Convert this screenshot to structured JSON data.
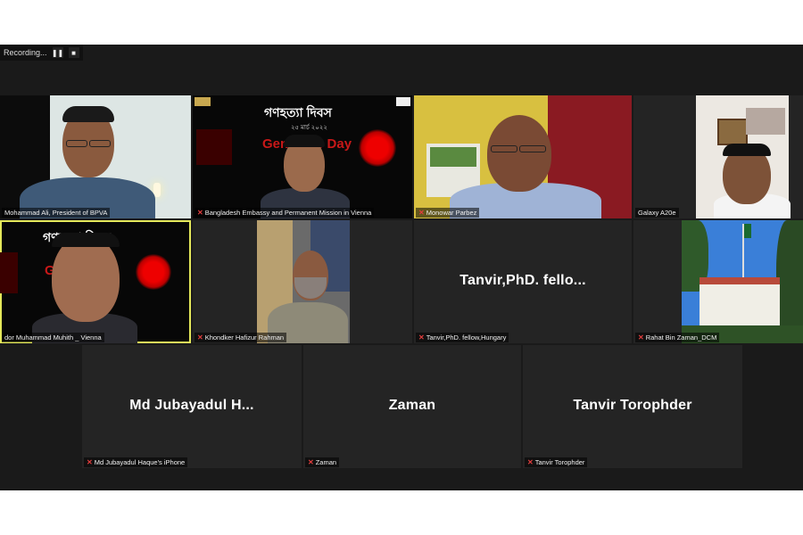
{
  "recording": {
    "label": "Recording...",
    "pause_icon": "pause-icon",
    "stop_icon": "stop-icon"
  },
  "banner": {
    "title_bn": "গণহত্যা দিবস",
    "date_bn": "২৫ মার্চ ২০২২",
    "title_en": "Genocide Day"
  },
  "participants": [
    {
      "name": "Mohammad Ali, President of BPVA",
      "muted": false
    },
    {
      "name": "Bangladesh Embassy and Permanent Mission in Vienna",
      "muted": true
    },
    {
      "name": "Monowar Parbez",
      "muted": true
    },
    {
      "name": "Galaxy A20e",
      "muted": false
    },
    {
      "name": "dor Muhammad Muhith _ Vienna",
      "muted": false,
      "active_speaker": true
    },
    {
      "name": "Khondker Hafizur Rahman",
      "muted": true
    },
    {
      "name": "Tanvir,PhD. fellow,Hungary",
      "display": "Tanvir,PhD.  fello...",
      "muted": true
    },
    {
      "name": "Rahat Bin Zaman_DCM",
      "muted": true
    },
    {
      "name": "Md Jubayadul Haque's iPhone",
      "display": "Md  Jubayadul  H...",
      "muted": true
    },
    {
      "name": "Zaman",
      "display": "Zaman",
      "muted": true
    },
    {
      "name": "Tanvir Torophder",
      "display": "Tanvir  Torophder",
      "muted": true
    }
  ],
  "colors": {
    "background": "#1a1a1a",
    "tile": "#242424",
    "active_border": "#e4e85a",
    "muted_mic": "#e43d3d"
  }
}
